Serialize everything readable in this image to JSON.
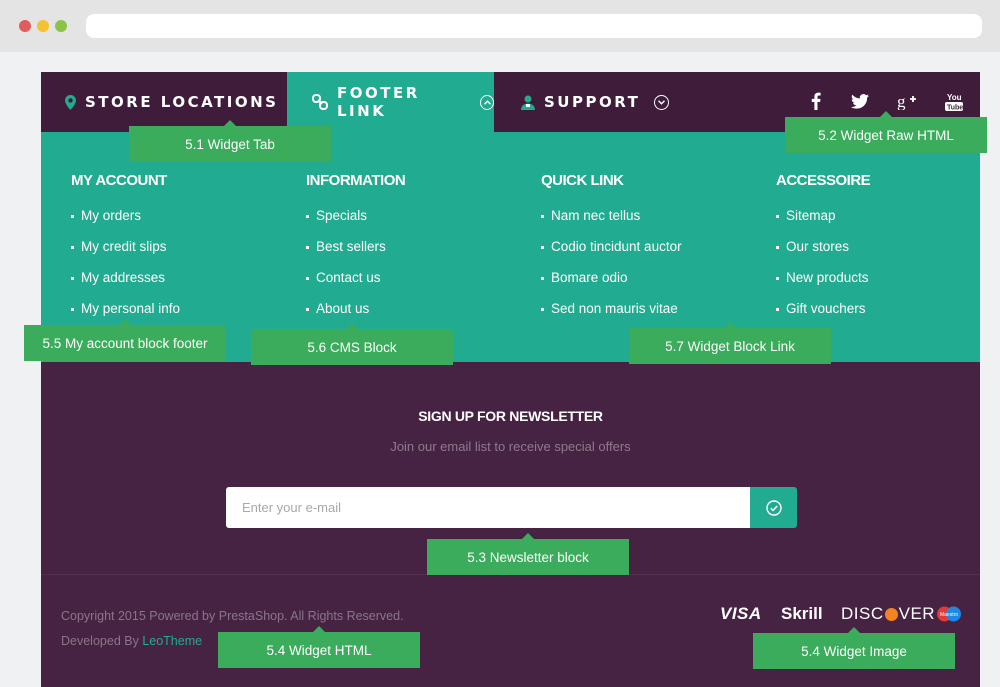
{
  "tabs": [
    {
      "label": "STORE LOCATIONS",
      "icon": "map-marker-icon",
      "state": "collapsed"
    },
    {
      "label": "FOOTER LINK",
      "icon": "link-icon",
      "state": "expanded"
    },
    {
      "label": "SUPPORT",
      "icon": "support-icon",
      "state": "collapsed"
    }
  ],
  "social": [
    "facebook-icon",
    "twitter-icon",
    "google-plus-icon",
    "youtube-icon"
  ],
  "columns": [
    {
      "title": "MY ACCOUNT",
      "items": [
        "My orders",
        "My credit slips",
        "My addresses",
        "My personal info"
      ]
    },
    {
      "title": "INFORMATION",
      "items": [
        "Specials",
        "Best sellers",
        "Contact us",
        "About us"
      ]
    },
    {
      "title": "QUICK LINK",
      "items": [
        "Nam nec tellus",
        "Codio tincidunt auctor",
        "Bomare odio",
        "Sed non mauris vitae"
      ]
    },
    {
      "title": "ACCESSOIRE",
      "items": [
        "Sitemap",
        "Our stores",
        "New products",
        "Gift vouchers"
      ]
    }
  ],
  "newsletter": {
    "title": "SIGN UP FOR NEWSLETTER",
    "subtitle": "Join our email list to receive special offers",
    "placeholder": "Enter your e-mail"
  },
  "footer": {
    "copyright": "Copyright 2015 Powered by PrestaShop. All Rights Reserved.",
    "developed_prefix": "Developed By",
    "developer_name": "LeoTheme",
    "payments": {
      "visa": "VISA",
      "skrill": "Skrill",
      "discover_a": "DISC",
      "discover_b": "VER",
      "maestro": "Maestro"
    }
  },
  "annotations": {
    "widget_tab": "5.1 Widget Tab",
    "widget_raw_html": "5.2 Widget Raw HTML",
    "my_account_block": "5.5 My account block footer",
    "cms_block": "5.6 CMS Block",
    "widget_block_link": "5.7 Widget Block Link",
    "newsletter_block": "5.3 Newsletter block",
    "widget_html": "5.4 Widget HTML",
    "widget_image": "5.4 Widget Image"
  },
  "colors": {
    "primary_green": "#21ab91",
    "purple_dark": "#3e1c3a",
    "purple": "#472343",
    "callout_green": "#3aac5b"
  }
}
